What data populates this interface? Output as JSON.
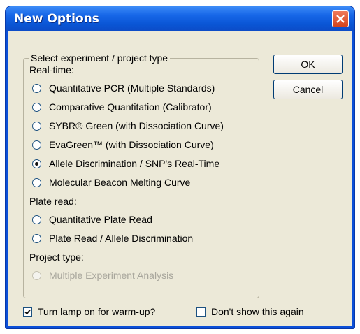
{
  "window": {
    "title": "New Options"
  },
  "group": {
    "title": "Select experiment / project  type",
    "realtime_label": "Real-time:",
    "realtime_options": [
      {
        "label": "Quantitative PCR (Multiple Standards)",
        "selected": false
      },
      {
        "label": "Comparative Quantitation (Calibrator)",
        "selected": false
      },
      {
        "label": "SYBR® Green (with Dissociation Curve)",
        "selected": false
      },
      {
        "label": "EvaGreen™ (with Dissociation Curve)",
        "selected": false
      },
      {
        "label": "Allele Discrimination / SNP's Real-Time",
        "selected": true
      },
      {
        "label": "Molecular Beacon Melting Curve",
        "selected": false
      }
    ],
    "plate_label": "Plate read:",
    "plate_options": [
      {
        "label": "Quantitative Plate Read",
        "selected": false
      },
      {
        "label": "Plate Read / Allele Discrimination",
        "selected": false
      }
    ],
    "project_label": "Project type:",
    "project_options": [
      {
        "label": "Multiple Experiment Analysis",
        "selected": false,
        "disabled": true
      }
    ]
  },
  "buttons": {
    "ok": "OK",
    "cancel": "Cancel"
  },
  "checks": {
    "lamp": {
      "label": "Turn lamp on for warm-up?",
      "checked": true
    },
    "dont_show": {
      "label": "Don't show this again",
      "checked": false
    }
  },
  "icons": {
    "close": "close-icon",
    "radio": "radio-icon",
    "checkbox_checked": "checkmark-icon"
  },
  "colors": {
    "titlebar": "#0b4fd8",
    "client_bg": "#ece9d8",
    "close_button": "#d3431c"
  }
}
